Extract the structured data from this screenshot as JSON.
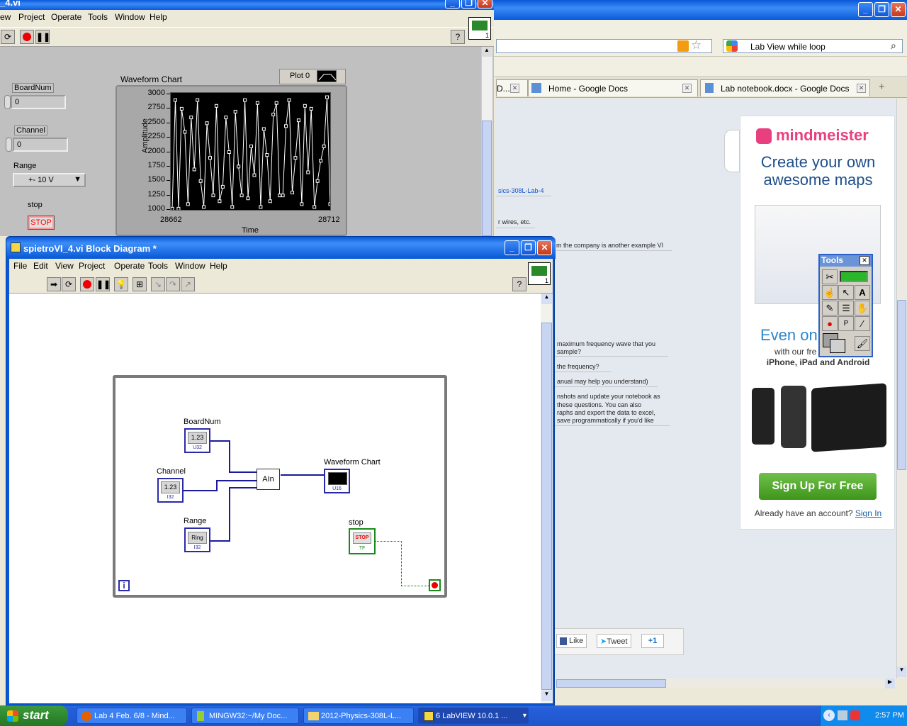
{
  "browser": {
    "search_value": "Lab View while loop",
    "tabs": [
      {
        "label": "D...",
        "close": "✕"
      },
      {
        "label": "Home - Google Docs",
        "close": "✕"
      },
      {
        "label": "Lab notebook.docx - Google Docs",
        "close": "✕"
      }
    ],
    "new_tab": "+",
    "doc": {
      "link": "sics-308L-Lab-4",
      "lines": [
        "r wires, etc.",
        "m the company is another example VI",
        "maximum frequency wave that you",
        "sample?",
        "the frequency?",
        "anual may help you understand)",
        "nshots and update your notebook as",
        "these questions.  You can also",
        "raphs and export the data to excel,",
        "save programmatically if you'd like"
      ]
    },
    "ad": {
      "logo": "mindmeister",
      "headline_1": "Create your own",
      "headline_2": "awesome maps",
      "even": "Even on",
      "with_text": "with our fre",
      "devices": "iPhone, iPad and Android",
      "cta": "Sign Up For Free",
      "account_text": "Already have an account?",
      "signin": "Sign In"
    },
    "social": {
      "like": "Like",
      "tweet": "Tweet",
      "plusone": "+1"
    }
  },
  "front_panel": {
    "title": "_4.vi",
    "menu": [
      "ew",
      "Project",
      "Operate",
      "Tools",
      "Window",
      "Help"
    ],
    "controls": {
      "boardnum_label": "BoardNum",
      "boardnum_value": "0",
      "channel_label": "Channel",
      "channel_value": "0",
      "range_label": "Range",
      "range_value": "+- 10 V",
      "stop_label": "stop",
      "stop_button": "STOP"
    },
    "help_icon": "?",
    "vi_icon_number": "1"
  },
  "chart_data": {
    "type": "line",
    "title": "Waveform Chart",
    "legend": "Plot 0",
    "xlabel": "Time",
    "ylabel": "Amplitude",
    "xlim": [
      28662,
      28712
    ],
    "ylim": [
      1000,
      3000
    ],
    "x_tick_labels": [
      "28662",
      "28712"
    ],
    "y_tick_labels": [
      "3000",
      "2750",
      "2500",
      "2250",
      "2000",
      "1750",
      "1500",
      "1250",
      "1000"
    ],
    "grid": false,
    "series": [
      {
        "color": "#ffffff",
        "x": [
          28662,
          28663,
          28664,
          28665,
          28666,
          28667,
          28668,
          28669,
          28670,
          28671,
          28672,
          28673,
          28674,
          28675,
          28676,
          28677,
          28678,
          28679,
          28680,
          28681,
          28682,
          28683,
          28684,
          28685,
          28686,
          28687,
          28688,
          28689,
          28690,
          28691,
          28692,
          28693,
          28694,
          28695,
          28696,
          28697,
          28698,
          28699,
          28700,
          28701,
          28702,
          28703,
          28704,
          28705,
          28706,
          28707,
          28708,
          28709,
          28710,
          28711,
          28712
        ],
        "values": [
          1020,
          2900,
          1020,
          2750,
          2350,
          1100,
          2600,
          1700,
          2900,
          1500,
          1050,
          2500,
          1900,
          1250,
          2800,
          1150,
          1400,
          2600,
          2000,
          1050,
          2700,
          1750,
          1250,
          2900,
          1200,
          2100,
          1600,
          2850,
          1050,
          2400,
          1950,
          1150,
          2650,
          2850,
          1250,
          1250,
          2450,
          2900,
          1300,
          1900,
          2550,
          1100,
          2800,
          1650,
          2750,
          1050,
          1500,
          1850,
          2100,
          2950,
          1100
        ]
      }
    ]
  },
  "block_diagram": {
    "title": "spietroVI_4.vi Block Diagram *",
    "menu": [
      "File",
      "Edit",
      "View",
      "Project",
      "Operate",
      "Tools",
      "Window",
      "Help"
    ],
    "help_icon": "?",
    "vi_icon_number": "1",
    "nodes": {
      "boardnum": {
        "label": "BoardNum",
        "value": "1.23",
        "type": "U32"
      },
      "channel": {
        "label": "Channel",
        "value": "1.23",
        "type": "I32"
      },
      "range": {
        "label": "Range",
        "value": "Ring",
        "type": "I32"
      },
      "ain": "AIn",
      "chart": {
        "label": "Waveform Chart",
        "type": "U16"
      },
      "stop": {
        "label": "stop",
        "value": "STOP",
        "type": "TF"
      },
      "iteration": "i"
    }
  },
  "tools_palette": {
    "title": "Tools",
    "close": "✕"
  },
  "taskbar": {
    "start": "start",
    "tasks": [
      "Lab 4 Feb. 6/8 - Mind...",
      "MINGW32:~/My Doc...",
      "2012-Physics-308L-L...",
      "6 LabVIEW 10.0.1 ..."
    ],
    "clock": "2:57 PM"
  },
  "colors": {
    "xp_blue": "#0a58d8",
    "labview_wire": "#1a1a9a",
    "bool_wire": "#006000",
    "stop_red": "#ff0000",
    "signup_green": "#4fa32a"
  }
}
